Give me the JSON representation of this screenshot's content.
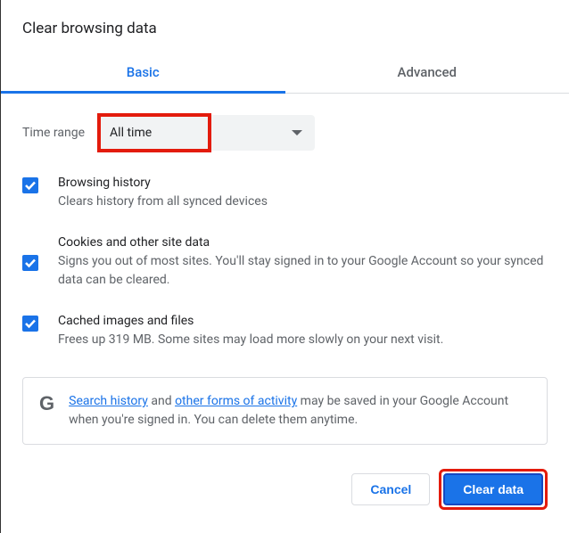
{
  "dialog": {
    "title": "Clear browsing data",
    "tabs": {
      "basic": "Basic",
      "advanced": "Advanced"
    },
    "timerange": {
      "label": "Time range",
      "value": "All time"
    },
    "options": [
      {
        "title": "Browsing history",
        "desc": "Clears history from all synced devices"
      },
      {
        "title": "Cookies and other site data",
        "desc": "Signs you out of most sites. You'll stay signed in to your Google Account so your synced data can be cleared."
      },
      {
        "title": "Cached images and files",
        "desc": "Frees up 319 MB. Some sites may load more slowly on your next visit."
      }
    ],
    "notice": {
      "link1": "Search history",
      "mid1": " and ",
      "link2": "other forms of activity",
      "rest": " may be saved in your Google Account when you're signed in. You can delete them anytime."
    },
    "buttons": {
      "cancel": "Cancel",
      "confirm": "Clear data"
    }
  }
}
